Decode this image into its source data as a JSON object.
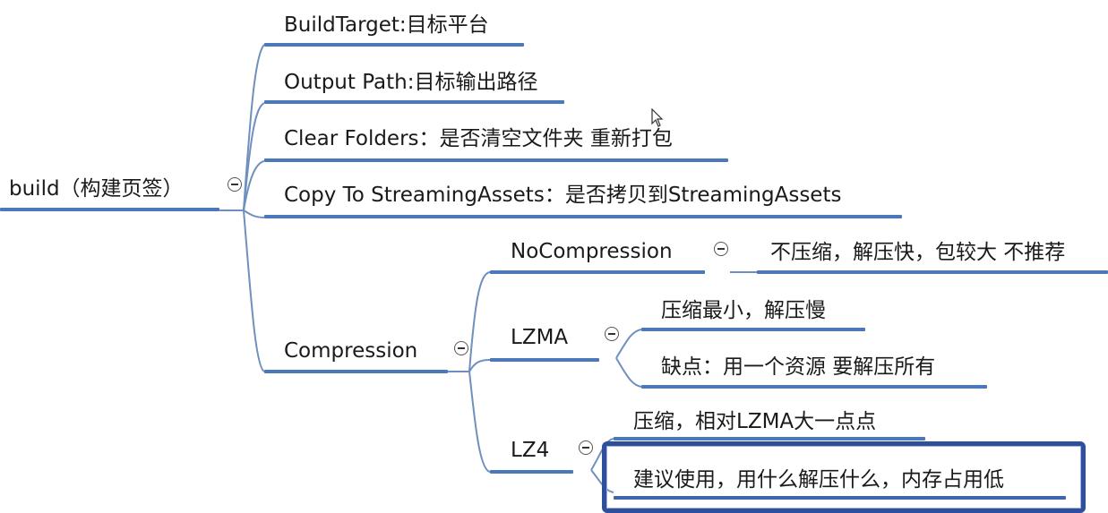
{
  "root": {
    "label": "build（构建页签）"
  },
  "branches": [
    {
      "label": "BuildTarget:目标平台"
    },
    {
      "label": "Output Path:目标输出路径"
    },
    {
      "label": "Clear Folders：是否清空文件夹 重新打包"
    },
    {
      "label": "Copy To StreamingAssets：是否拷贝到StreamingAssets"
    },
    {
      "label": "Compression"
    }
  ],
  "compression": {
    "options": [
      {
        "label": "NoCompression",
        "notes": [
          "不压缩，解压快，包较大 不推荐"
        ]
      },
      {
        "label": "LZMA",
        "notes": [
          "压缩最小，解压慢",
          "缺点：用一个资源 要解压所有"
        ]
      },
      {
        "label": "LZ4",
        "notes": [
          "压缩，相对LZMA大一点点",
          "建议使用，用什么解压什么，内存占用低"
        ]
      }
    ]
  },
  "colors": {
    "line": "#4a78b8",
    "connector": "#6f8fbf",
    "highlight": "#2f4f9c"
  },
  "icons": {
    "collapse": "minus-circle-icon",
    "cursor": "mouse-pointer-icon"
  }
}
